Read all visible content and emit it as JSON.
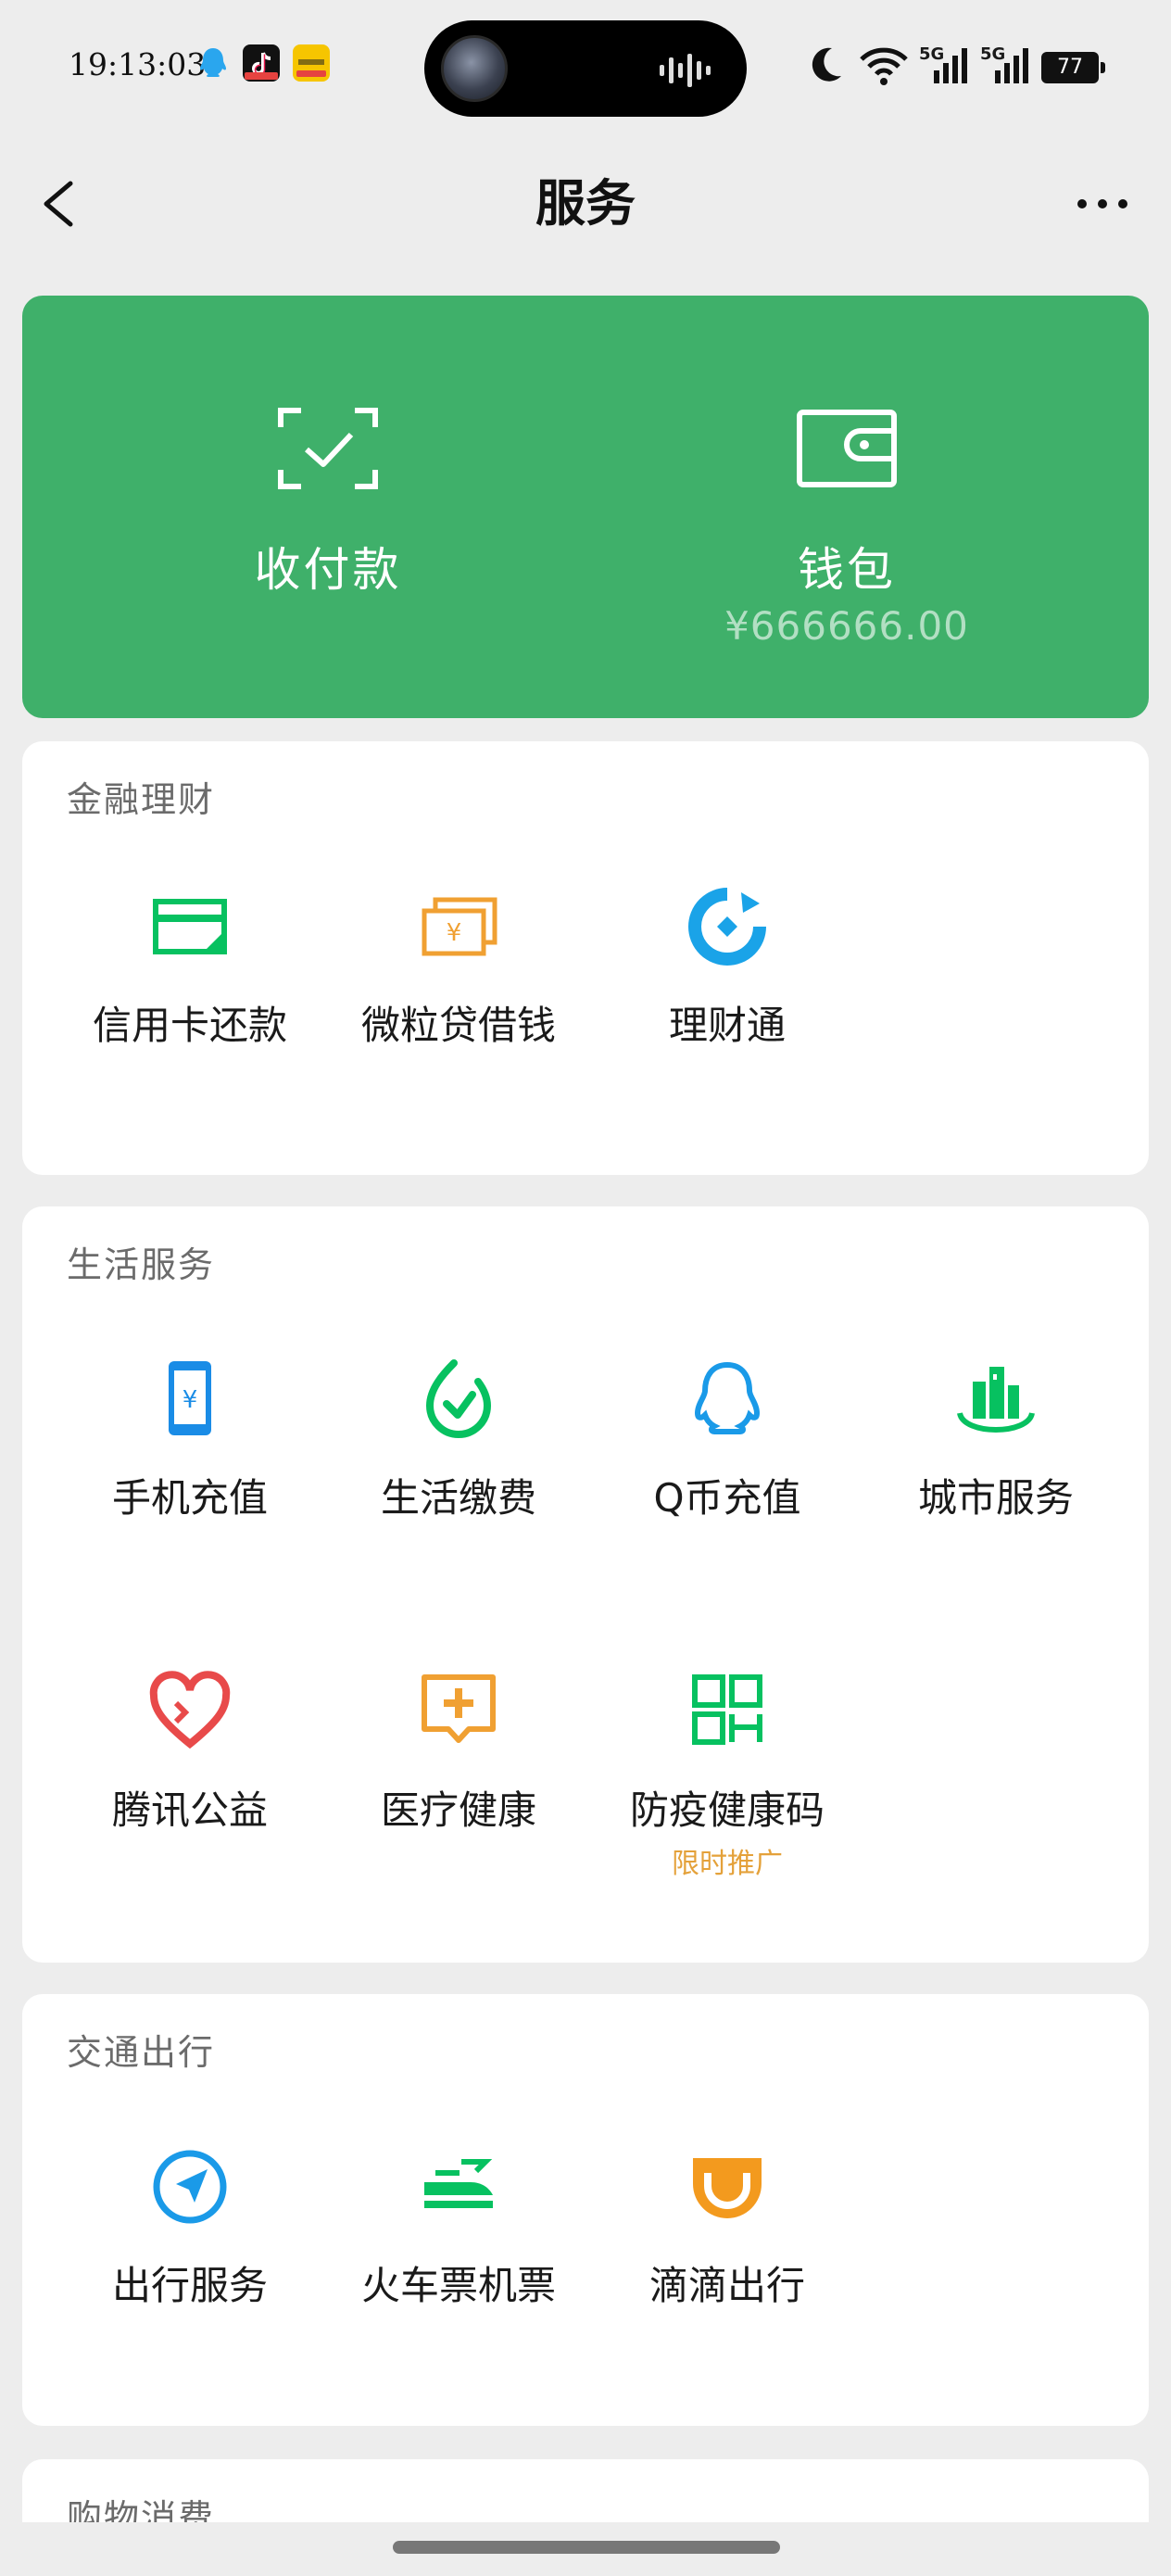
{
  "status_bar": {
    "time": "19:13:03",
    "battery": "77",
    "network_1": "5G",
    "network_2": "5G"
  },
  "nav": {
    "title": "服务"
  },
  "banner": {
    "pay_label": "收付款",
    "wallet_label": "钱包",
    "wallet_balance": "¥666666.00",
    "color": "#3fb06a"
  },
  "sections": {
    "finance": {
      "title": "金融理财",
      "items": [
        {
          "label": "信用卡还款",
          "icon": "credit-card-icon"
        },
        {
          "label": "微粒贷借钱",
          "icon": "loan-icon"
        },
        {
          "label": "理财通",
          "icon": "wealth-icon"
        }
      ]
    },
    "life": {
      "title": "生活服务",
      "items": [
        {
          "label": "手机充值",
          "icon": "phone-topup-icon"
        },
        {
          "label": "生活缴费",
          "icon": "utility-bill-icon"
        },
        {
          "label": "Q币充值",
          "icon": "qq-coin-icon"
        },
        {
          "label": "城市服务",
          "icon": "city-service-icon"
        },
        {
          "label": "腾讯公益",
          "icon": "charity-icon"
        },
        {
          "label": "医疗健康",
          "icon": "medical-icon"
        },
        {
          "label": "防疫健康码",
          "icon": "health-code-icon",
          "tag": "限时推广"
        }
      ]
    },
    "travel": {
      "title": "交通出行",
      "items": [
        {
          "label": "出行服务",
          "icon": "travel-service-icon"
        },
        {
          "label": "火车票机票",
          "icon": "train-ticket-icon"
        },
        {
          "label": "滴滴出行",
          "icon": "didi-icon"
        }
      ]
    },
    "shopping": {
      "title": "购物消费"
    }
  }
}
